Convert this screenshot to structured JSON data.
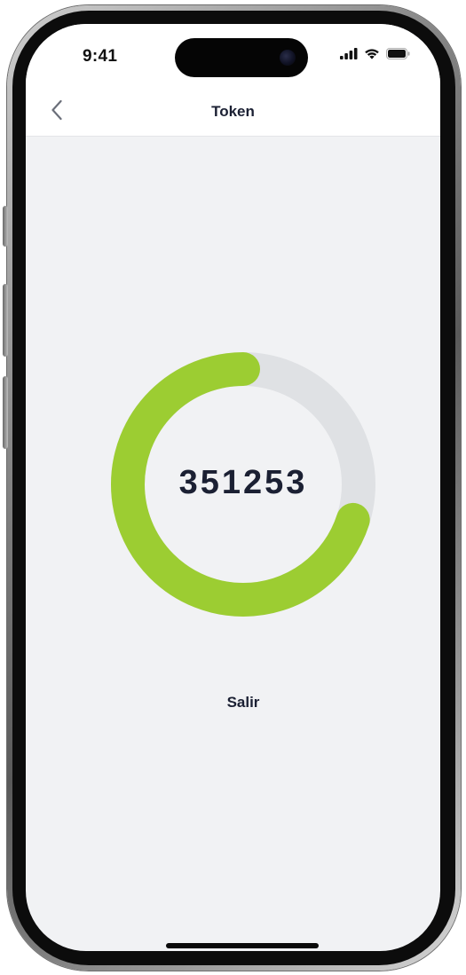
{
  "status_bar": {
    "time": "9:41",
    "icons": [
      "cellular-signal-icon",
      "wifi-icon",
      "battery-icon"
    ]
  },
  "nav": {
    "title": "Token",
    "back_icon": "chevron-left-icon"
  },
  "token": {
    "code": "351253",
    "progress_fraction": 0.7,
    "progress_color": "#9ccd32",
    "track_color": "#dfe1e4"
  },
  "actions": {
    "exit_label": "Salir"
  },
  "colors": {
    "background": "#f1f2f4",
    "header": "#ffffff",
    "text": "#1b2033"
  }
}
